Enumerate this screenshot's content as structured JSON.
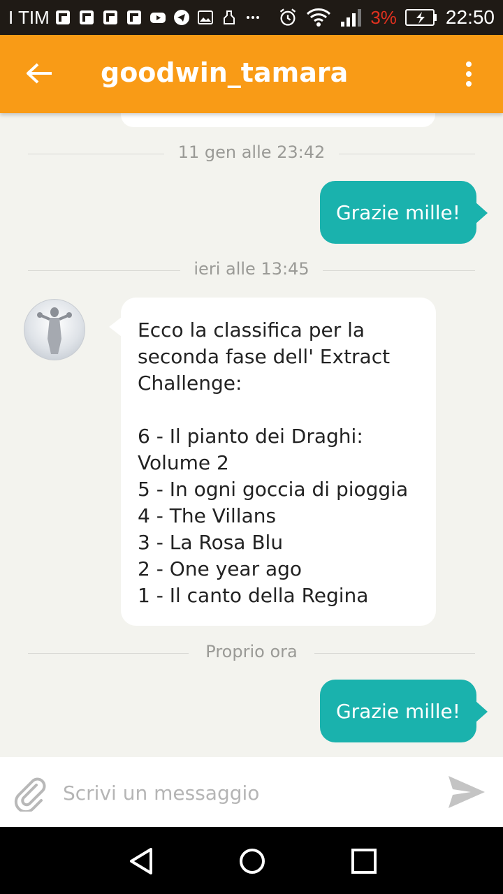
{
  "status_bar": {
    "carrier": "I TIM",
    "battery_percent": "3%",
    "time": "22:50",
    "notification_icons": [
      "flipboard-icon",
      "flipboard-icon",
      "flipboard-icon",
      "flipboard-icon",
      "youtube-icon",
      "telegram-icon",
      "gallery-icon",
      "cleaner-icon",
      "more-icon"
    ],
    "status_icons": [
      "alarm-icon",
      "wifi-icon",
      "signal-icon",
      "battery-charging-icon"
    ]
  },
  "app_bar": {
    "title": "goodwin_tamara",
    "back_icon": "arrow-back-icon",
    "menu_icon": "more-vert-icon",
    "color": "#f99b16"
  },
  "messages": [
    {
      "type": "separator",
      "label": "11 gen alle 23:42"
    },
    {
      "type": "sent",
      "text": "Grazie mille!"
    },
    {
      "type": "separator",
      "label": "ieri alle 13:45"
    },
    {
      "type": "received",
      "text": "Ecco la classifica per la seconda fase dell' Extract Challenge:\n\n6 - Il pianto dei Draghi: Volume 2\n5 - In ogni goccia di pioggia\n4 - The Villans\n3 - La Rosa Blu\n2 - One year ago\n1 - Il canto della Regina"
    },
    {
      "type": "separator",
      "label": "Proprio ora"
    },
    {
      "type": "sent",
      "text": "Grazie mille!"
    }
  ],
  "composer": {
    "placeholder": "Scrivi un messaggio",
    "value": "",
    "attach_icon": "paperclip-icon",
    "send_icon": "send-icon"
  },
  "nav_bar": {
    "buttons": [
      "back-triangle-icon",
      "home-circle-icon",
      "recents-square-icon"
    ]
  },
  "colors": {
    "accent": "#f99b16",
    "sent_bubble": "#1ab2ad",
    "chat_background": "#f3f3ee",
    "battery_low": "#e0311f"
  }
}
